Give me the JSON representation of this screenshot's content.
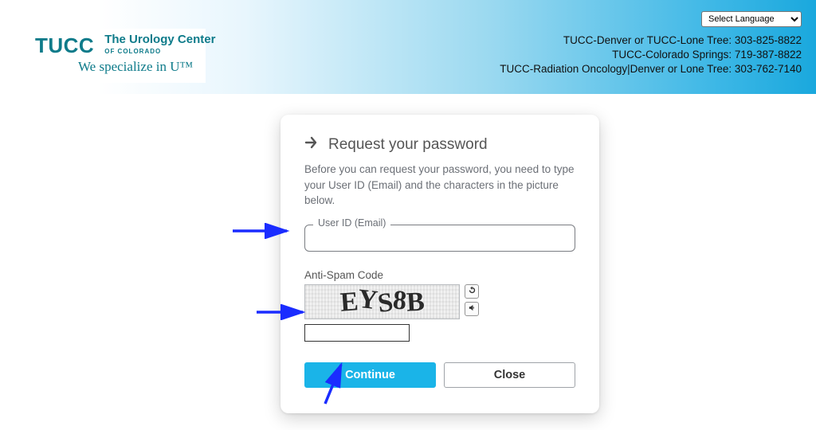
{
  "header": {
    "logo": {
      "abbr": "TUCC",
      "line1": "The Urology Center",
      "line2": "OF COLORADO",
      "tagline": "We specialize in U™"
    },
    "language_placeholder": "Select Language",
    "contacts": [
      "TUCC-Denver or TUCC-Lone Tree: 303-825-8822",
      "TUCC-Colorado Springs: 719-387-8822",
      "TUCC-Radiation Oncology|Denver or Lone Tree: 303-762-7140"
    ]
  },
  "card": {
    "title": "Request your password",
    "description": "Before you can request your password, you need to type your User ID (Email) and the characters in the picture below.",
    "userid_label": "User ID (Email)",
    "userid_value": "",
    "antispam_label": "Anti-Spam Code",
    "captcha_chars": [
      "E",
      "Y",
      "S",
      "8",
      "B"
    ],
    "captcha_refresh_label": "Refresh code",
    "captcha_audio_label": "Play audio code",
    "code_value": "",
    "continue_label": "Continue",
    "close_label": "Close"
  }
}
